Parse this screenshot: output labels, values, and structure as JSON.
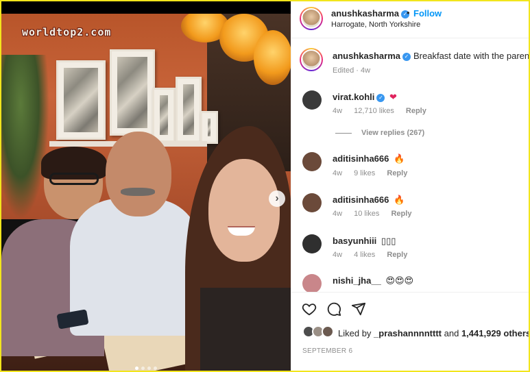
{
  "photo": {
    "watermark": "worldtop2.com",
    "next_label": "›",
    "carousel_dot_count": 4,
    "carousel_active_index": 0
  },
  "header": {
    "username": "anushkasharma",
    "verified_mark": "✓",
    "bullet": "•",
    "follow_label": "Follow",
    "location": "Harrogate, North Yorkshire"
  },
  "caption": {
    "username": "anushkasharma",
    "text": "Breakfast date with the parents ❤",
    "edited": "Edited",
    "time": "4w"
  },
  "comments": [
    {
      "username": "virat.kohli",
      "verified": true,
      "text": "❤",
      "time": "4w",
      "likes": "12,710 likes",
      "reply": "Reply",
      "avatar_color": "#3a3a3a"
    },
    {
      "username": "aditisinha666",
      "verified": false,
      "text": "🔥",
      "time": "4w",
      "likes": "9 likes",
      "reply": "Reply",
      "avatar_color": "#6b4a3a"
    },
    {
      "username": "aditisinha666",
      "verified": false,
      "text": "🔥",
      "time": "4w",
      "likes": "10 likes",
      "reply": "Reply",
      "avatar_color": "#6b4a3a"
    },
    {
      "username": "basyunhiii",
      "verified": false,
      "text": "▯▯▯",
      "time": "4w",
      "likes": "4 likes",
      "reply": "Reply",
      "avatar_color": "#2f2f2f"
    },
    {
      "username": "nishi_jha__",
      "verified": false,
      "text": "😍😍😍",
      "time": "",
      "likes": "",
      "reply": "",
      "avatar_color": "#c9868a"
    }
  ],
  "view_replies": "View replies (267)",
  "actions": {
    "like_icon": "heart-outline-icon",
    "comment_icon": "comment-icon",
    "share_icon": "send-icon"
  },
  "likes": {
    "prefix": "Liked by",
    "user": "_prashannnntttt",
    "middle": "and",
    "count": "1,441,929 others"
  },
  "post_date": "SEPTEMBER 6",
  "colors": {
    "follow_blue": "#0095f6",
    "verified_blue": "#3897f0",
    "frame_yellow": "#f2e51c"
  }
}
